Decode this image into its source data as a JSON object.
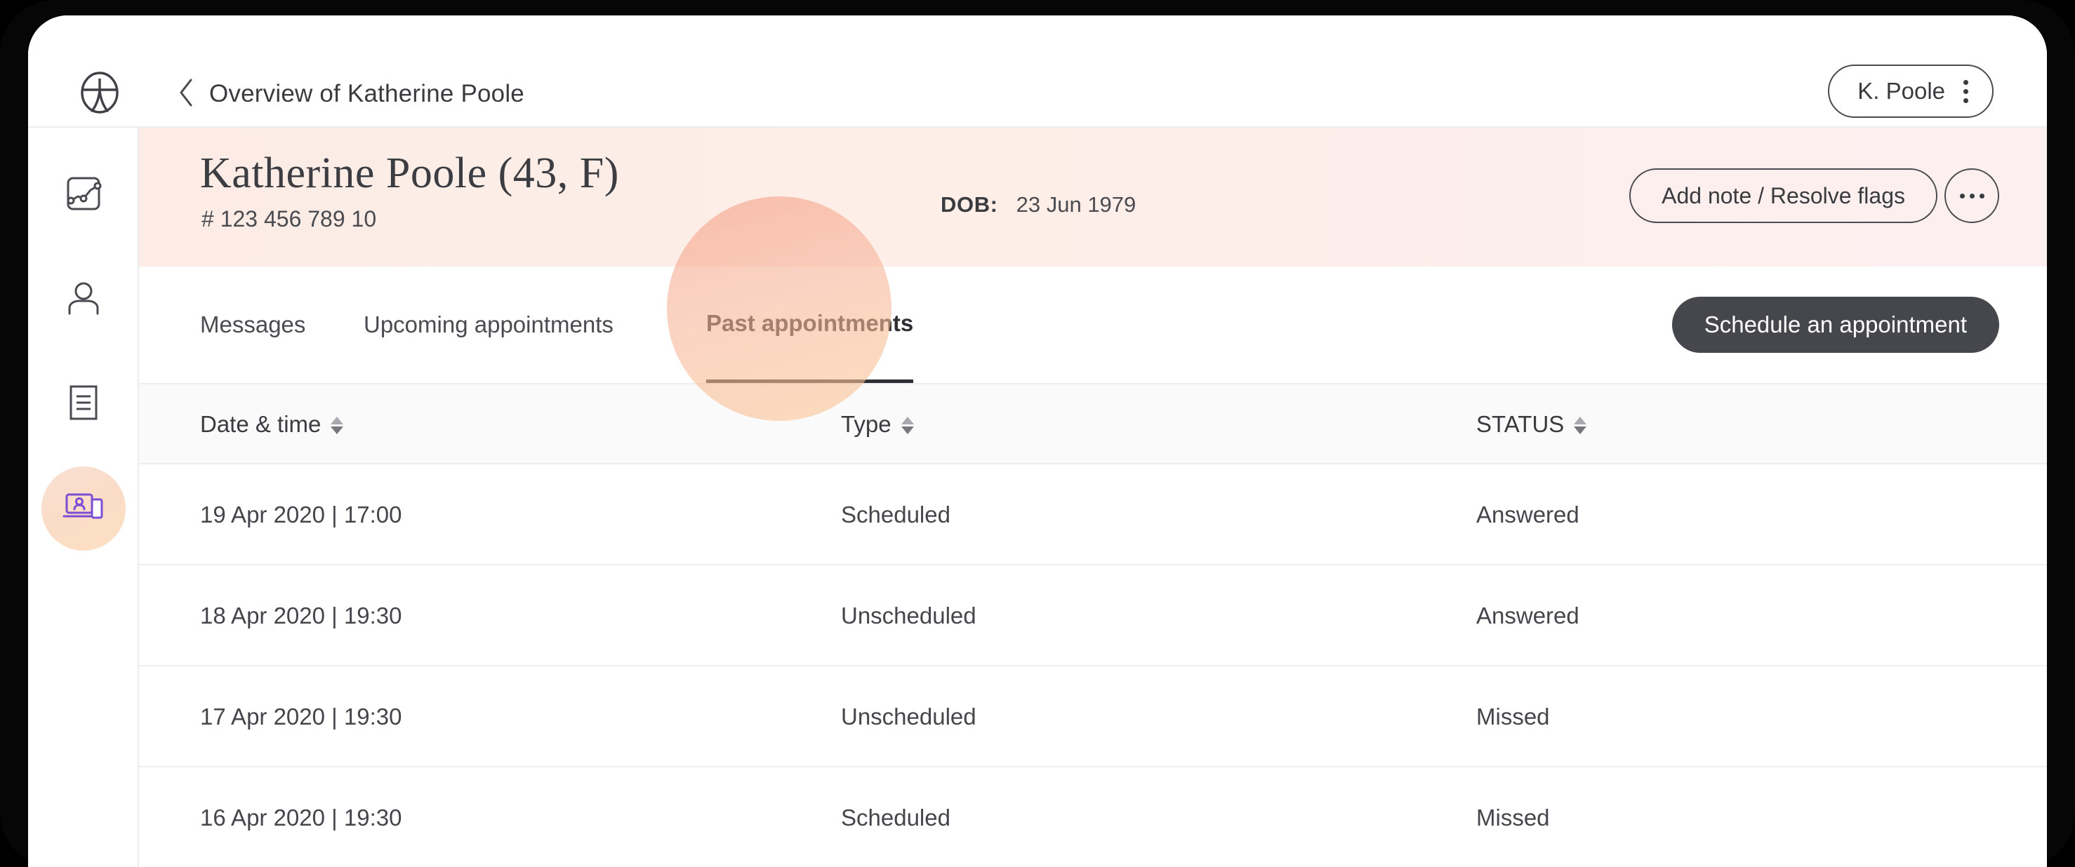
{
  "header": {
    "logo_icon": "clinic-logo-icon",
    "back_icon": "chevron-left-icon",
    "breadcrumb": "Overview of Katherine Poole",
    "user_chip": {
      "name": "K. Poole",
      "menu_icon": "kebab-menu-icon"
    }
  },
  "sidebar": {
    "items": [
      {
        "icon": "analytics-chart-icon",
        "active": false
      },
      {
        "icon": "user-profile-icon",
        "active": false
      },
      {
        "icon": "document-notes-icon",
        "active": false
      },
      {
        "icon": "telehealth-consultation-icon",
        "active": true
      }
    ]
  },
  "patient": {
    "name": "Katherine Poole (43, F)",
    "id": "# 123 456 789 10",
    "dob_label": "DOB:",
    "dob_value": "23 Jun 1979",
    "add_note_label": "Add note / Resolve flags",
    "more_icon": "ellipsis-horizontal-icon",
    "banner_color": "#fcece5"
  },
  "tabs": {
    "items": [
      {
        "label": "Messages",
        "active": false
      },
      {
        "label": "Upcoming appointments",
        "active": false
      },
      {
        "label": "Past appointments",
        "active": true
      }
    ],
    "cta_label": "Schedule an appointment",
    "cta_color": "#46474c"
  },
  "table": {
    "columns": [
      {
        "label": "Date & time",
        "sortable": true
      },
      {
        "label": "Type",
        "sortable": true
      },
      {
        "label": "STATUS",
        "sortable": true
      }
    ],
    "rows": [
      {
        "date": "19 Apr 2020 | 17:00",
        "type": "Scheduled",
        "status": "Answered"
      },
      {
        "date": "18 Apr 2020 | 19:30",
        "type": "Unscheduled",
        "status": "Answered"
      },
      {
        "date": "17 Apr 2020 | 19:30",
        "type": "Unscheduled",
        "status": "Missed"
      },
      {
        "date": "16 Apr 2020 | 19:30",
        "type": "Scheduled",
        "status": "Missed"
      }
    ]
  },
  "overlay": {
    "cursor_highlight_icon": "cursor-highlight-blob"
  }
}
